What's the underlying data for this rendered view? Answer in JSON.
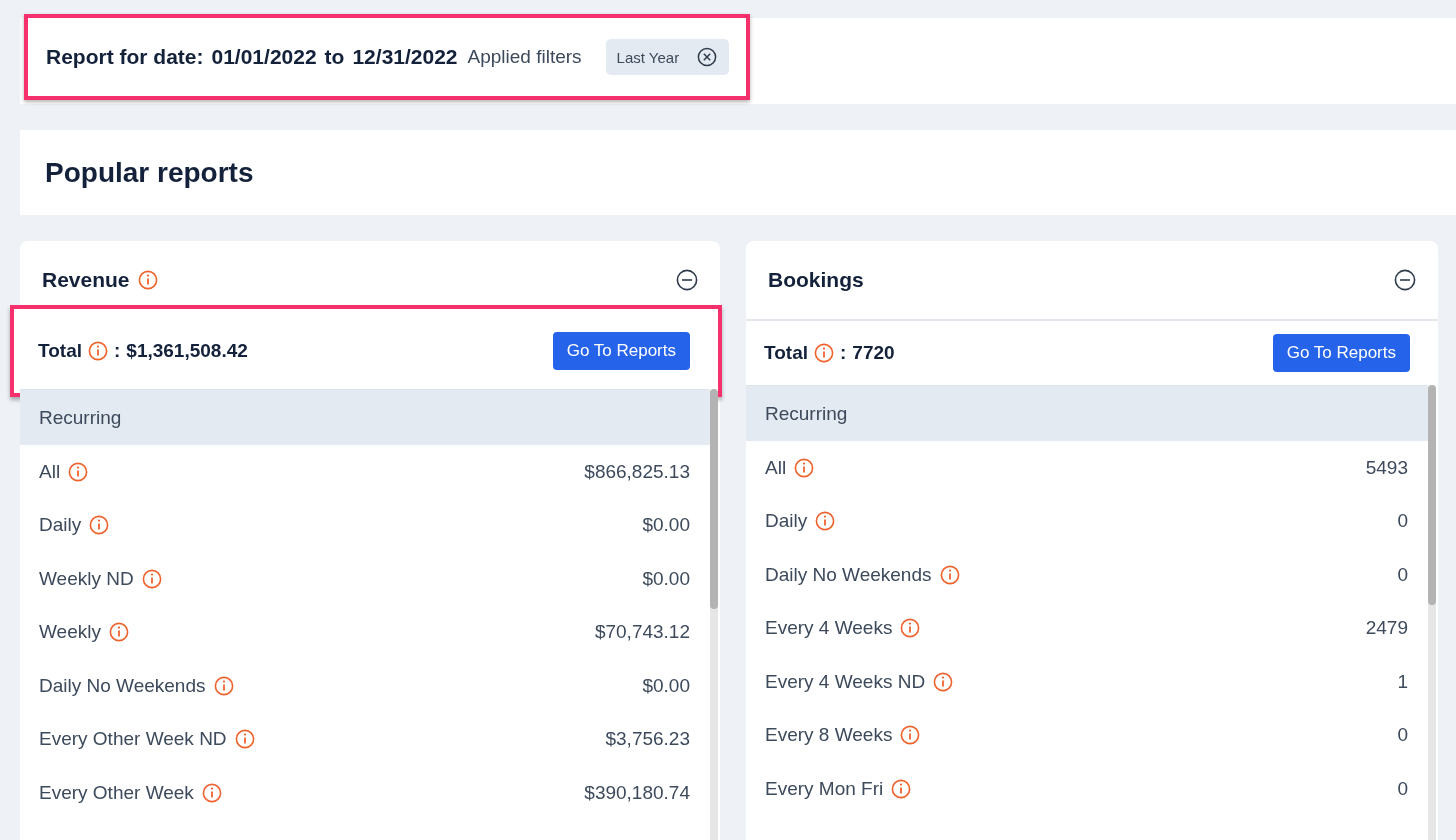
{
  "filter_bar": {
    "highlighted": true,
    "label": "Report for date:",
    "date_from": "01/01/2022",
    "connector": "to",
    "date_to": "12/31/2022",
    "filters_label": "Applied filters",
    "chips": [
      {
        "label": "Last Year"
      }
    ]
  },
  "section_title": "Popular reports",
  "cards": [
    {
      "title": "Revenue",
      "title_info": true,
      "total": {
        "label": "Total",
        "separator": ":",
        "value": "$1,361,508.42",
        "highlighted": true
      },
      "button": "Go To Reports",
      "group": "Recurring",
      "rows": [
        {
          "label": "All",
          "value": "$866,825.13"
        },
        {
          "label": "Daily",
          "value": "$0.00"
        },
        {
          "label": "Weekly ND",
          "value": "$0.00"
        },
        {
          "label": "Weekly",
          "value": "$70,743.12"
        },
        {
          "label": "Daily No Weekends",
          "value": "$0.00"
        },
        {
          "label": "Every Other Week ND",
          "value": "$3,756.23"
        },
        {
          "label": "Every Other Week",
          "value": "$390,180.74"
        }
      ]
    },
    {
      "title": "Bookings",
      "title_info": false,
      "total": {
        "label": "Total",
        "separator": ":",
        "value": "7720",
        "highlighted": false
      },
      "button": "Go To Reports",
      "group": "Recurring",
      "rows": [
        {
          "label": "All",
          "value": "5493"
        },
        {
          "label": "Daily",
          "value": "0"
        },
        {
          "label": "Daily No Weekends",
          "value": "0"
        },
        {
          "label": "Every 4 Weeks",
          "value": "2479"
        },
        {
          "label": "Every 4 Weeks ND",
          "value": "1"
        },
        {
          "label": "Every 8 Weeks",
          "value": "0"
        },
        {
          "label": "Every Mon Fri",
          "value": "0"
        }
      ]
    }
  ]
}
